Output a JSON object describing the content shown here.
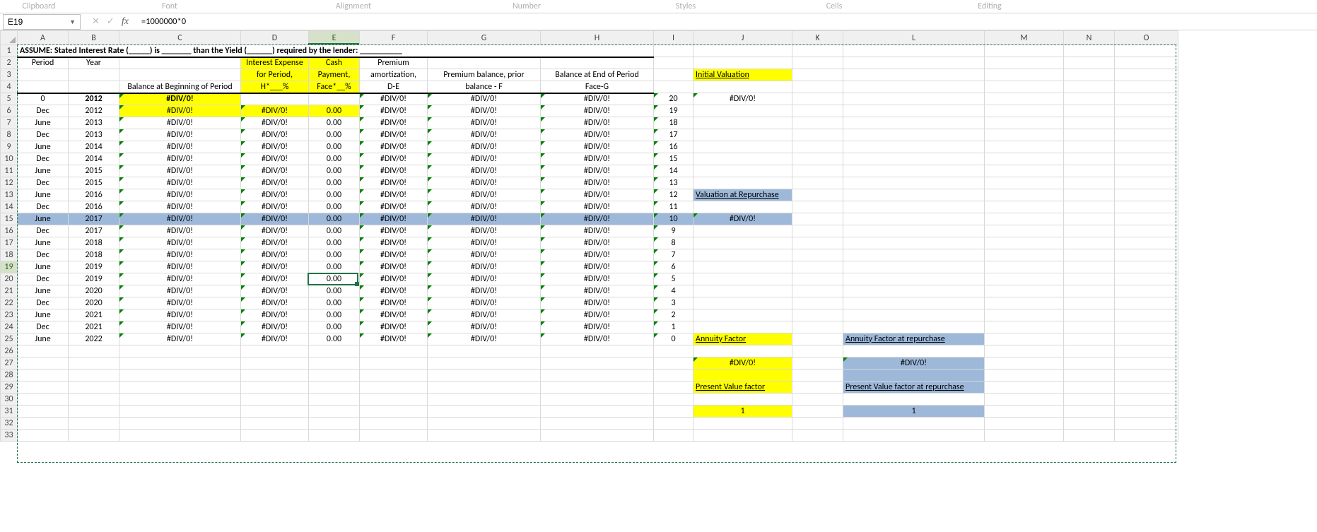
{
  "ribbon_groups": [
    "Clipboard",
    "Font",
    "Alignment",
    "Number",
    "Styles",
    "Cells",
    "Editing"
  ],
  "name_box": "E19",
  "formula": "=1000000*0",
  "col_widths": {
    "rowhdr": 24,
    "A": 72,
    "B": 72,
    "C": 172,
    "D": 96,
    "E": 72,
    "F": 96,
    "G": 160,
    "H": 160,
    "I": 56,
    "J": 140,
    "K": 72,
    "L": 200,
    "M": 112,
    "N": 72,
    "O": 90
  },
  "columns": [
    "A",
    "B",
    "C",
    "D",
    "E",
    "F",
    "G",
    "H",
    "I",
    "J",
    "K",
    "L",
    "M",
    "N",
    "O"
  ],
  "selected_col": "E",
  "selected_row": 19,
  "row1_text": "ASSUME: Stated Interest Rate (_____) is _______  than the Yield (______) required by the lender: __________",
  "headers": {
    "A2": "Period",
    "B2": "Year",
    "D2": "Interest Expense",
    "E2": "Cash",
    "F2": "Premium",
    "D3": "for Period,",
    "E3": "Payment,",
    "F3": "amortization,",
    "G3": "Premium balance, prior",
    "H3": "Balance at End of Period",
    "J3": "Initial Valuation",
    "C4": "Balance at Beginning of Period",
    "D4": "H*___%",
    "E4": "Face*__%",
    "F4": "D-E",
    "G4": "balance - F",
    "H4": "Face-G"
  },
  "div0": "#DIV/0!",
  "rows": [
    {
      "r": 5,
      "A": "0",
      "B": "2012",
      "Bbold": true,
      "C": "#DIV/0!",
      "Cbold": true,
      "Chl": true,
      "D": "",
      "E": "",
      "F": "#DIV/0!",
      "G": "#DIV/0!",
      "H": "#DIV/0!",
      "I": "20",
      "J": "#DIV/0!"
    },
    {
      "r": 6,
      "A": "Dec",
      "B": "2012",
      "C": "#DIV/0!",
      "Chl": true,
      "D": "#DIV/0!",
      "Dhl": true,
      "E": "0.00",
      "Ehl": true,
      "F": "#DIV/0!",
      "G": "#DIV/0!",
      "H": "#DIV/0!",
      "I": "19"
    },
    {
      "r": 7,
      "A": "June",
      "B": "2013",
      "C": "#DIV/0!",
      "D": "#DIV/0!",
      "E": "0.00",
      "F": "#DIV/0!",
      "G": "#DIV/0!",
      "H": "#DIV/0!",
      "I": "18"
    },
    {
      "r": 8,
      "A": "Dec",
      "B": "2013",
      "C": "#DIV/0!",
      "D": "#DIV/0!",
      "E": "0.00",
      "F": "#DIV/0!",
      "G": "#DIV/0!",
      "H": "#DIV/0!",
      "I": "17"
    },
    {
      "r": 9,
      "A": "June",
      "B": "2014",
      "C": "#DIV/0!",
      "D": "#DIV/0!",
      "E": "0.00",
      "F": "#DIV/0!",
      "G": "#DIV/0!",
      "H": "#DIV/0!",
      "I": "16"
    },
    {
      "r": 10,
      "A": "Dec",
      "B": "2014",
      "C": "#DIV/0!",
      "D": "#DIV/0!",
      "E": "0.00",
      "F": "#DIV/0!",
      "G": "#DIV/0!",
      "H": "#DIV/0!",
      "I": "15"
    },
    {
      "r": 11,
      "A": "June",
      "B": "2015",
      "C": "#DIV/0!",
      "D": "#DIV/0!",
      "E": "0.00",
      "F": "#DIV/0!",
      "G": "#DIV/0!",
      "H": "#DIV/0!",
      "I": "14"
    },
    {
      "r": 12,
      "A": "Dec",
      "B": "2015",
      "C": "#DIV/0!",
      "D": "#DIV/0!",
      "E": "0.00",
      "F": "#DIV/0!",
      "G": "#DIV/0!",
      "H": "#DIV/0!",
      "I": "13"
    },
    {
      "r": 13,
      "A": "June",
      "B": "2016",
      "C": "#DIV/0!",
      "D": "#DIV/0!",
      "E": "0.00",
      "F": "#DIV/0!",
      "G": "#DIV/0!",
      "H": "#DIV/0!",
      "I": "12",
      "J": "Valuation at Repurchase",
      "Jblue": true,
      "Junder": true
    },
    {
      "r": 14,
      "A": "Dec",
      "B": "2016",
      "C": "#DIV/0!",
      "D": "#DIV/0!",
      "E": "0.00",
      "F": "#DIV/0!",
      "G": "#DIV/0!",
      "H": "#DIV/0!",
      "I": "11"
    },
    {
      "r": 15,
      "A": "June",
      "B": "2017",
      "C": "#DIV/0!",
      "D": "#DIV/0!",
      "E": "0.00",
      "F": "#DIV/0!",
      "G": "#DIV/0!",
      "H": "#DIV/0!",
      "I": "10",
      "J": "#DIV/0!",
      "rowblue": true
    },
    {
      "r": 16,
      "A": "Dec",
      "B": "2017",
      "C": "#DIV/0!",
      "D": "#DIV/0!",
      "E": "0.00",
      "F": "#DIV/0!",
      "G": "#DIV/0!",
      "H": "#DIV/0!",
      "I": "9"
    },
    {
      "r": 17,
      "A": "June",
      "B": "2018",
      "C": "#DIV/0!",
      "D": "#DIV/0!",
      "E": "0.00",
      "F": "#DIV/0!",
      "G": "#DIV/0!",
      "H": "#DIV/0!",
      "I": "8"
    },
    {
      "r": 18,
      "A": "Dec",
      "B": "2018",
      "C": "#DIV/0!",
      "D": "#DIV/0!",
      "E": "0.00",
      "F": "#DIV/0!",
      "G": "#DIV/0!",
      "H": "#DIV/0!",
      "I": "7"
    },
    {
      "r": 19,
      "A": "June",
      "B": "2019",
      "C": "#DIV/0!",
      "D": "#DIV/0!",
      "E": "0.00",
      "F": "#DIV/0!",
      "G": "#DIV/0!",
      "H": "#DIV/0!",
      "I": "6"
    },
    {
      "r": 20,
      "A": "Dec",
      "B": "2019",
      "C": "#DIV/0!",
      "D": "#DIV/0!",
      "E": "0.00",
      "F": "#DIV/0!",
      "G": "#DIV/0!",
      "H": "#DIV/0!",
      "I": "5"
    },
    {
      "r": 21,
      "A": "June",
      "B": "2020",
      "C": "#DIV/0!",
      "D": "#DIV/0!",
      "E": "0.00",
      "F": "#DIV/0!",
      "G": "#DIV/0!",
      "H": "#DIV/0!",
      "I": "4"
    },
    {
      "r": 22,
      "A": "Dec",
      "B": "2020",
      "C": "#DIV/0!",
      "D": "#DIV/0!",
      "E": "0.00",
      "F": "#DIV/0!",
      "G": "#DIV/0!",
      "H": "#DIV/0!",
      "I": "3"
    },
    {
      "r": 23,
      "A": "June",
      "B": "2021",
      "C": "#DIV/0!",
      "D": "#DIV/0!",
      "E": "0.00",
      "F": "#DIV/0!",
      "G": "#DIV/0!",
      "H": "#DIV/0!",
      "I": "2"
    },
    {
      "r": 24,
      "A": "Dec",
      "B": "2021",
      "C": "#DIV/0!",
      "D": "#DIV/0!",
      "E": "0.00",
      "F": "#DIV/0!",
      "G": "#DIV/0!",
      "H": "#DIV/0!",
      "I": "1"
    },
    {
      "r": 25,
      "A": "June",
      "B": "2022",
      "C": "#DIV/0!",
      "D": "#DIV/0!",
      "E": "0.00",
      "F": "#DIV/0!",
      "G": "#DIV/0!",
      "H": "#DIV/0!",
      "I": "0",
      "J": "Annuity Factor",
      "Jyellow": true,
      "Junder": true,
      "L": "Annuity Factor at repurchase",
      "Lblue": true,
      "Lunder": true
    }
  ],
  "extra_rows": [
    {
      "r": 26
    },
    {
      "r": 27,
      "J": "#DIV/0!",
      "Jyellow": true,
      "L": "#DIV/0!",
      "Lblue": true
    },
    {
      "r": 28,
      "Jyellow": true,
      "Lblue": true
    },
    {
      "r": 29,
      "J": "Present Value factor",
      "Jyellow": true,
      "Junder": true,
      "L": "Present Value factor at repurchase",
      "Lblue": true,
      "Lunder": true
    },
    {
      "r": 30
    },
    {
      "r": 31,
      "J": "1",
      "Jyellow": true,
      "L": "1",
      "Lblue": true
    },
    {
      "r": 32
    },
    {
      "r": 33
    }
  ]
}
